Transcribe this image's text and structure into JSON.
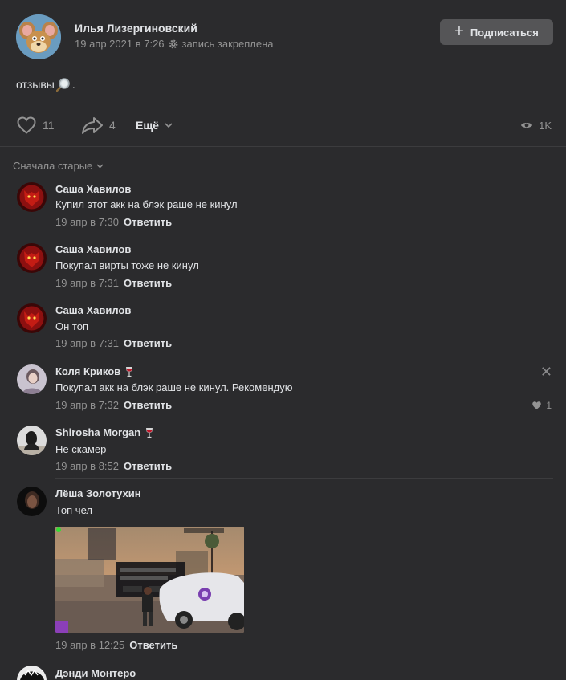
{
  "post": {
    "author": "Илья Лизергиновский",
    "date": "19 апр 2021 в 7:26",
    "pinned": "запись закреплена",
    "subscribe_label": "Подписаться",
    "text": "отзывы",
    "text_suffix": "."
  },
  "actions": {
    "likes": "11",
    "shares": "4",
    "more": "Ещё",
    "views": "1K"
  },
  "comments_sort": "Сначала старые",
  "comments": [
    {
      "author": "Саша Хавилов",
      "text": "Купил этот акк на блэк раше не кинул",
      "date": "19 апр в 7:30",
      "reply": "Ответить"
    },
    {
      "author": "Саша Хавилов",
      "text": "Покупал вирты тоже не кинул",
      "date": "19 апр в 7:31",
      "reply": "Ответить"
    },
    {
      "author": "Саша Хавилов",
      "text": "Он топ",
      "date": "19 апр в 7:31",
      "reply": "Ответить"
    },
    {
      "author": "Коля Криков",
      "text": "Покупал акк на блэк раше не кинул. Рекомендую",
      "date": "19 апр в 7:32",
      "reply": "Ответить",
      "likes": "1"
    },
    {
      "author": "Shirosha Morgan",
      "text": "Не скамер",
      "date": "19 апр в 8:52",
      "reply": "Ответить"
    },
    {
      "author": "Лёша Золотухин",
      "text": "Топ чел",
      "date": "19 апр в 12:25",
      "reply": "Ответить"
    },
    {
      "author": "Дэнди Монтеро"
    }
  ],
  "colors": {
    "background": "#2b2b2d",
    "text_primary": "#e1e3e6",
    "text_secondary": "#939393",
    "button": "#555557",
    "separator": "#3c3c3e"
  }
}
